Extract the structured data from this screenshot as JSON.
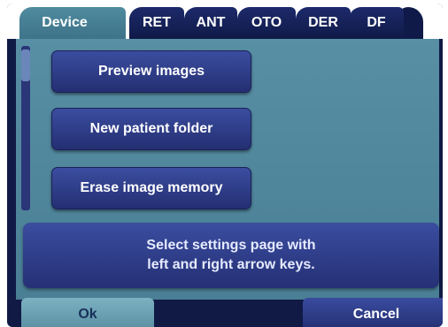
{
  "tabs": [
    {
      "label": "Device",
      "active": true
    },
    {
      "label": "RET",
      "active": false
    },
    {
      "label": "ANT",
      "active": false
    },
    {
      "label": "OTO",
      "active": false
    },
    {
      "label": "DER",
      "active": false
    },
    {
      "label": "DF",
      "active": false
    }
  ],
  "buttons": {
    "preview": "Preview images",
    "new_folder": "New patient folder",
    "erase": "Erase image memory"
  },
  "message": {
    "line1": "Select settings page with",
    "line2": "left and right arrow keys."
  },
  "footer": {
    "ok": "Ok",
    "cancel": "Cancel"
  },
  "colors": {
    "accent_teal": "#588fa5",
    "button_navy": "#2f3d8a",
    "background": "#101a45"
  }
}
